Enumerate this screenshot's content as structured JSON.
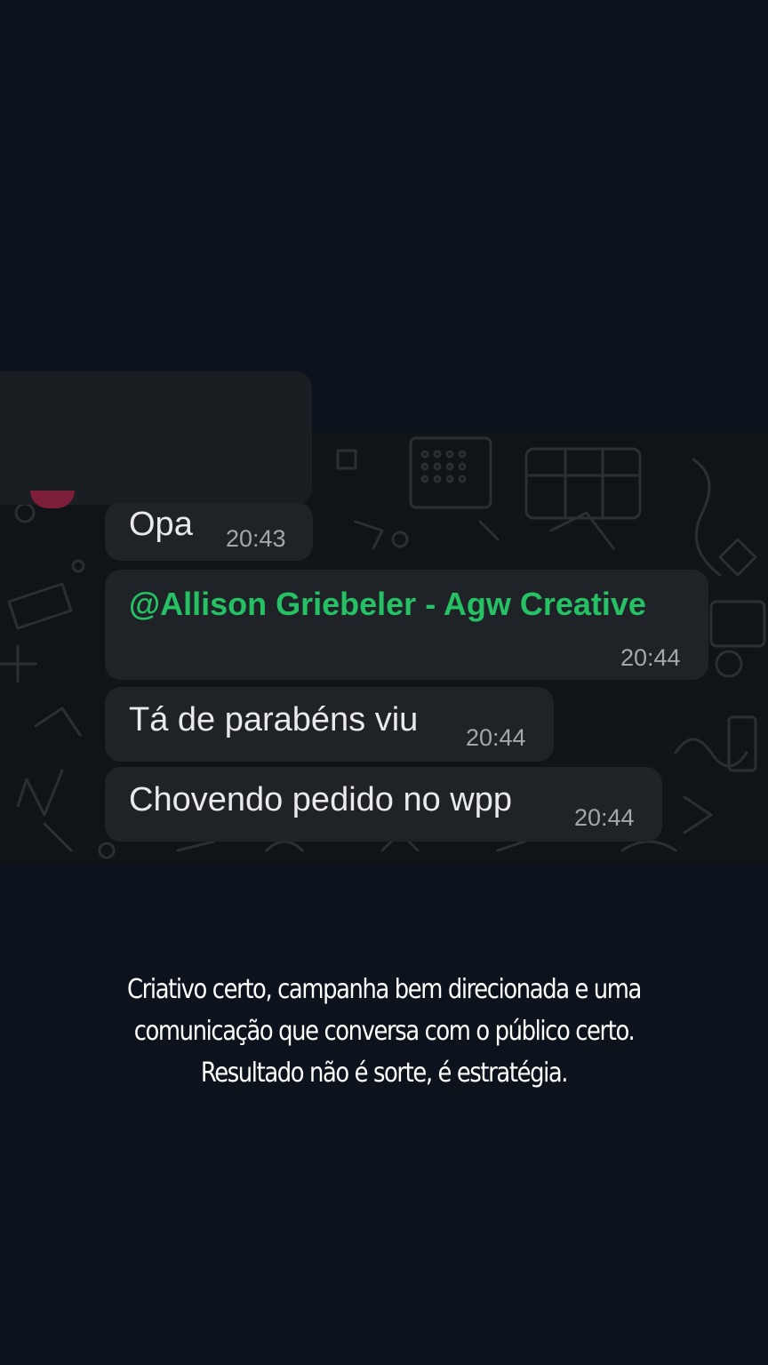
{
  "messages": [
    {
      "text": "Opa",
      "time": "20:43"
    },
    {
      "text": "@Allison Griebeler - Agw Creative",
      "time": "20:44",
      "is_mention": true
    },
    {
      "text": "Tá de parabéns viu",
      "time": "20:44"
    },
    {
      "text": "Chovendo pedido no wpp",
      "time": "20:44"
    }
  ],
  "caption": {
    "line1": "Criativo certo, campanha bem direcionada e uma",
    "line2": "comunicação que conversa com o público certo.",
    "line3": "Resultado não é sorte, é estratégia."
  },
  "colors": {
    "page_background": "#0d131c",
    "bubble": "#1f2226",
    "mention": "#25c164",
    "timestamp": "#a3a7ab"
  }
}
